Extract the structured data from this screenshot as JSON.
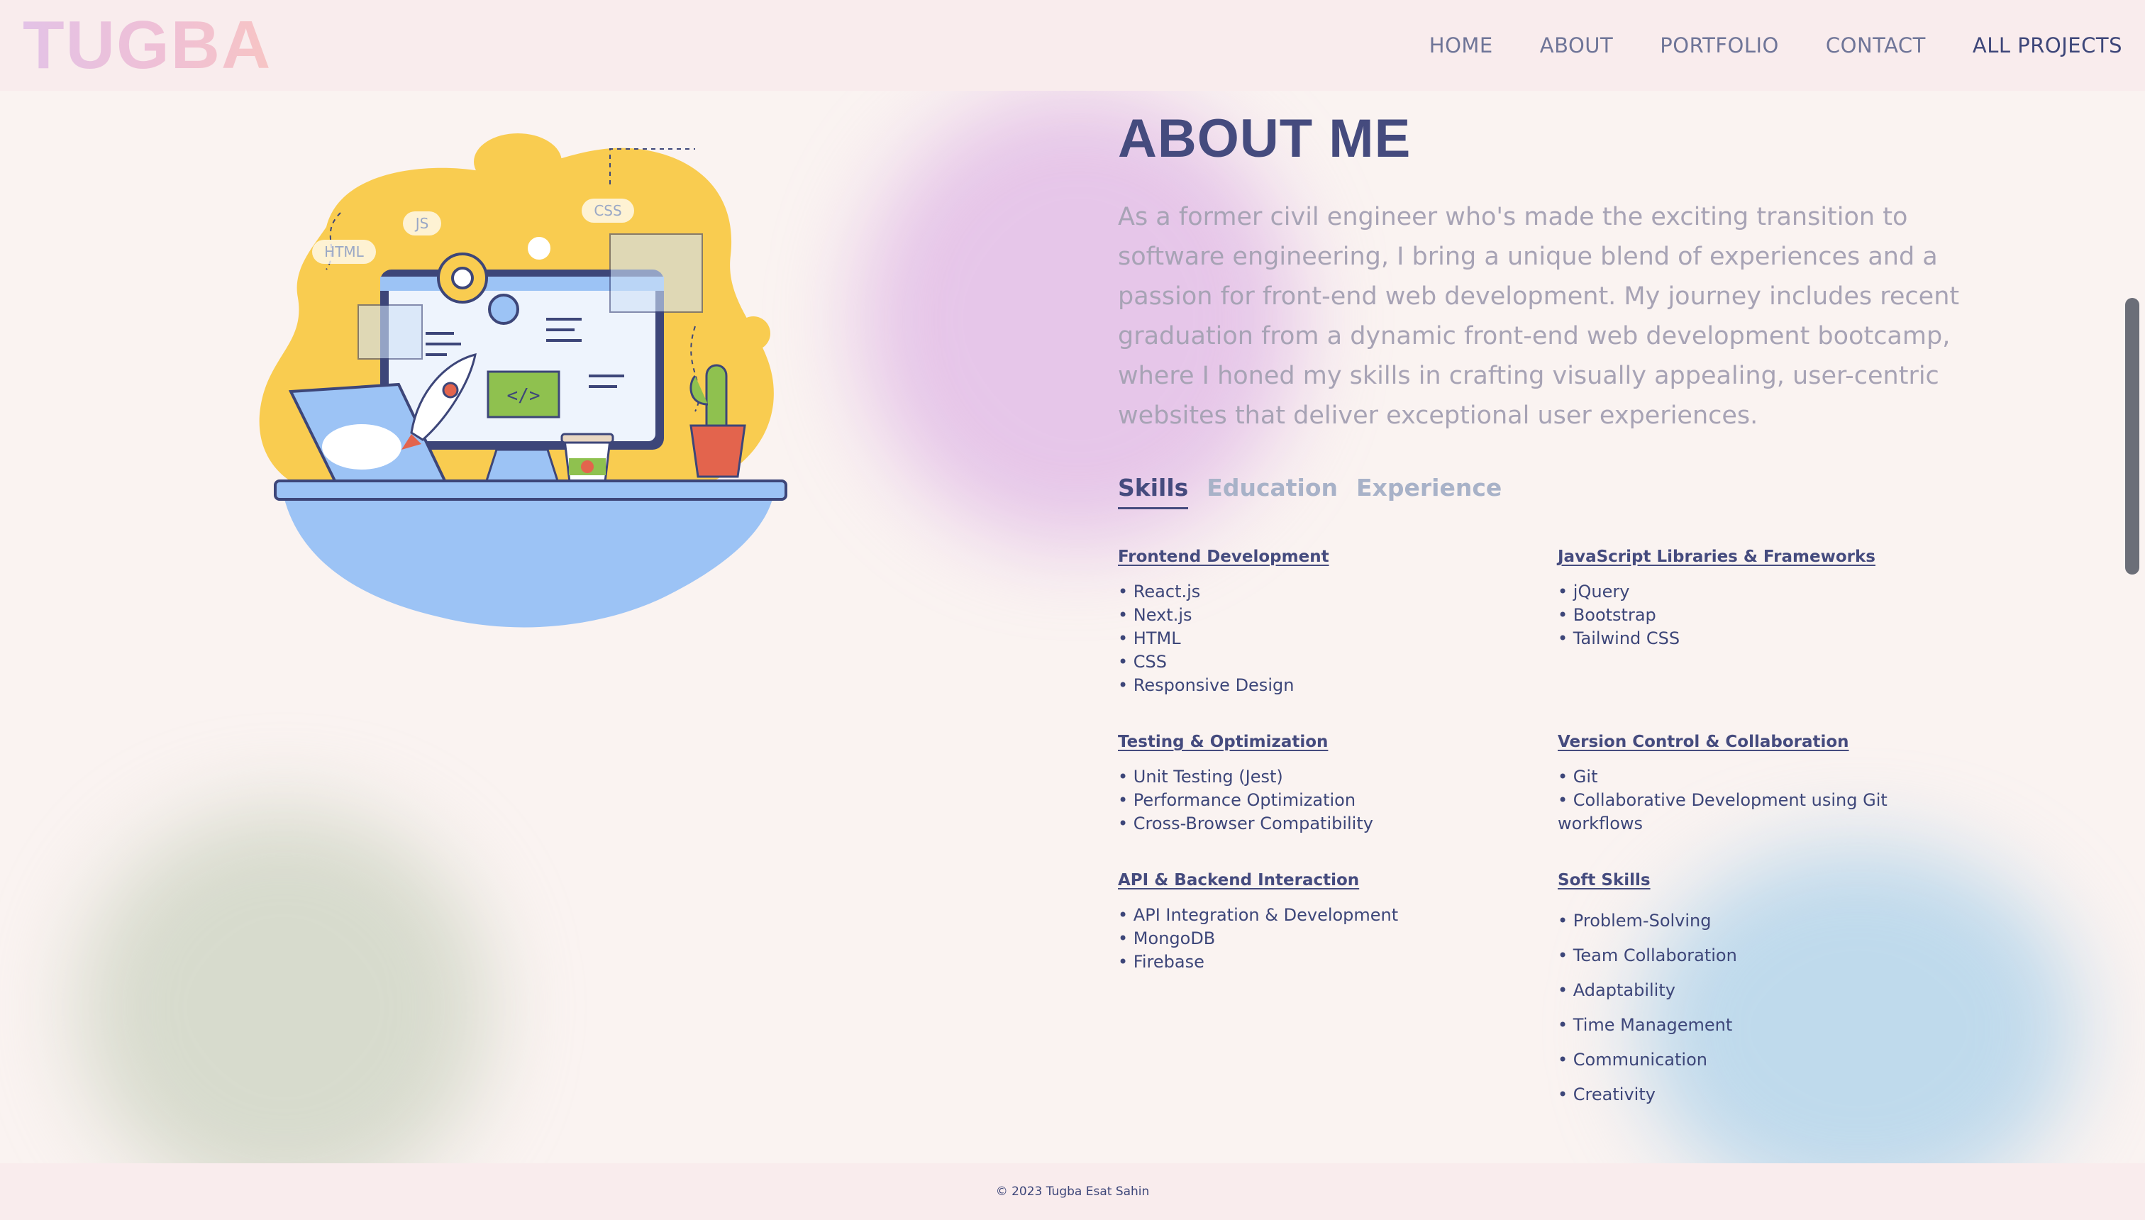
{
  "header": {
    "logo": "TUGBA",
    "nav": [
      "HOME",
      "ABOUT",
      "PORTFOLIO",
      "CONTACT",
      "ALL PROJECTS"
    ]
  },
  "about": {
    "title": "ABOUT ME",
    "intro": "As a former civil engineer who's made the exciting transition to software engineering, I bring a unique blend of experiences and a passion for front-end web development. My journey includes recent graduation from a dynamic front-end web development bootcamp, where I honed my skills in crafting visually appealing, user-centric websites that deliver exceptional user experiences.",
    "tabs": [
      "Skills",
      "Education",
      "Experience"
    ]
  },
  "illustration": {
    "labels": [
      "HTML",
      "JS",
      "CSS"
    ],
    "code_glyph": "</>"
  },
  "skills": [
    {
      "title": "Frontend Development",
      "items": [
        "React.js",
        "Next.js",
        "HTML",
        "CSS",
        "Responsive Design"
      ]
    },
    {
      "title": "JavaScript Libraries & Frameworks",
      "items": [
        "jQuery",
        "Bootstrap",
        "Tailwind CSS"
      ]
    },
    {
      "title": "Testing & Optimization",
      "items": [
        "Unit Testing (Jest)",
        "Performance Optimization",
        "Cross-Browser Compatibility"
      ]
    },
    {
      "title": "Version Control & Collaboration",
      "items": [
        "Git",
        "Collaborative Development using Git workflows"
      ]
    },
    {
      "title": "API & Backend Interaction",
      "items": [
        "API Integration & Development",
        "MongoDB",
        "Firebase"
      ]
    },
    {
      "title": "Soft Skills",
      "items": [
        "Problem-Solving",
        "Team Collaboration",
        "Adaptability",
        "Time Management",
        "Communication",
        "Creativity"
      ]
    }
  ],
  "footer": {
    "text": "© 2023 Tugba Esat Sahin"
  },
  "colors": {
    "background": "#faf3f1",
    "header_bg": "#f9eced",
    "primary": "#454b7e",
    "muted_text": "#a7a3b5",
    "tab_inactive": "#a8b2c8",
    "illustration_yellow": "#f9cc50",
    "illustration_blue": "#9cc3f5"
  }
}
